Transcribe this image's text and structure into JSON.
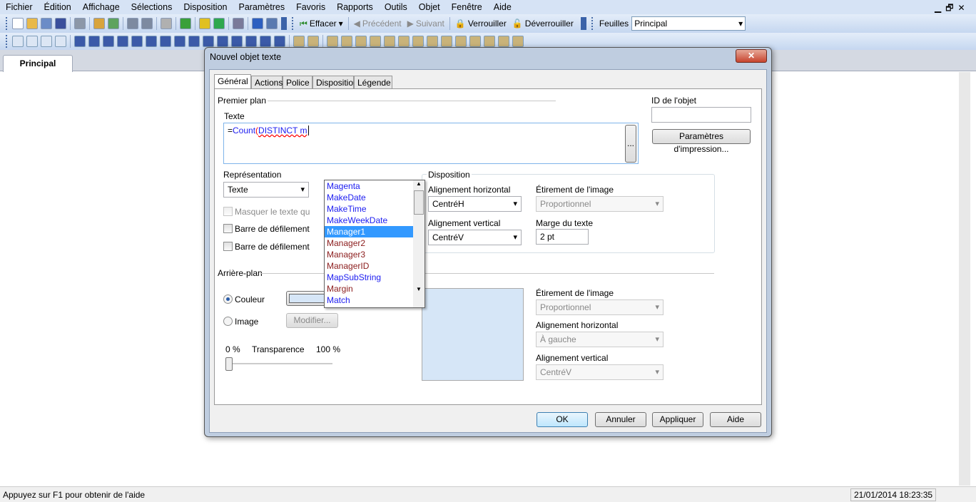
{
  "menu": [
    "Fichier",
    "Édition",
    "Affichage",
    "Sélections",
    "Disposition",
    "Paramètres",
    "Favoris",
    "Rapports",
    "Outils",
    "Objet",
    "Fenêtre",
    "Aide"
  ],
  "toolbar1": {
    "icons": [
      "new-document-icon",
      "open-folder-icon",
      "reload-icon",
      "save-icon",
      "print-icon",
      "edit-script-icon",
      "reload-data-icon",
      "undo-icon",
      "redo-icon",
      "search-icon",
      "checkmark-icon",
      "chart-wizard-icon",
      "favorite-star-icon",
      "edit-icon",
      "help-icon",
      "whats-this-icon"
    ],
    "effacer": "Effacer",
    "precedent": "Précédent",
    "suivant": "Suivant",
    "verrouiller": "Verrouiller",
    "deverrouiller": "Déverrouiller",
    "feuilles_label": "Feuilles",
    "feuille_value": "Principal"
  },
  "toolbar2": {
    "icons": [
      "new-sheet-icon",
      "move-left-icon",
      "move-right-icon",
      "sheet-properties-icon",
      "listbox-icon",
      "statistics-box-icon",
      "multibox-icon",
      "table-box-icon",
      "chart-icon",
      "input-box-icon",
      "current-selections-icon",
      "button-icon",
      "text-object-icon",
      "line-arrow-icon",
      "slider-icon",
      "bookmark-icon",
      "search-object-icon",
      "container-icon",
      "custom-object-icon",
      "format-painter-icon",
      "brush-icon",
      "align-icon",
      "align-left-icon",
      "align-center-icon",
      "align-right-icon",
      "align-bottom-icon",
      "align-middle-icon",
      "align-top-icon",
      "space-horizontal-icon",
      "space-vertical-icon",
      "lock-icon",
      "key-icon",
      "note-icon",
      "tools-icon",
      "chart-small-icon"
    ]
  },
  "sheet_tab": "Principal",
  "status": {
    "help": "Appuyez sur F1 pour obtenir de l'aide",
    "datetime": "21/01/2014 18:23:35"
  },
  "dialog": {
    "title": "Nouvel objet texte",
    "close": "✕",
    "tabs": [
      "Général",
      "Actions",
      "Police",
      "Disposition",
      "Légende"
    ],
    "premier_plan": "Premier plan",
    "texte_label": "Texte",
    "expr": {
      "eq": "=",
      "fn": "Count",
      "paren": "(",
      "rest": "DISTINCT m"
    },
    "expr_button": "...",
    "autocomplete": [
      {
        "text": "Magenta",
        "kind": "fn"
      },
      {
        "text": "MakeDate",
        "kind": "fn"
      },
      {
        "text": "MakeTime",
        "kind": "fn"
      },
      {
        "text": "MakeWeekDate",
        "kind": "fn"
      },
      {
        "text": "Manager1",
        "kind": "sel"
      },
      {
        "text": "Manager2",
        "kind": "fld"
      },
      {
        "text": "Manager3",
        "kind": "fld"
      },
      {
        "text": "ManagerID",
        "kind": "fld"
      },
      {
        "text": "MapSubString",
        "kind": "fn"
      },
      {
        "text": "Margin",
        "kind": "fld"
      },
      {
        "text": "Match",
        "kind": "fn"
      }
    ],
    "id_label": "ID de l'objet",
    "id_value": "",
    "print_params": "Paramètres d'impression...",
    "representation_label": "Représentation",
    "representation_value": "Texte",
    "masquer": "Masquer le texte quand...",
    "barre_h": "Barre de défilement horizontale",
    "barre_v": "Barre de défilement verticale",
    "disposition": {
      "title": "Disposition",
      "align_h_label": "Alignement horizontal",
      "align_h": "CentréH",
      "etirement_label": "Étirement de l'image",
      "etirement": "Proportionnel",
      "align_v_label": "Alignement vertical",
      "align_v": "CentréV",
      "marge_label": "Marge du texte",
      "marge": "2 pt"
    },
    "arriere_plan": "Arrière-plan",
    "couleur": "Couleur",
    "image": "Image",
    "modifier": "Modifier...",
    "color_value": "#d6e6f7",
    "transp_min": "0 %",
    "transp_label": "Transparence",
    "transp_max": "100 %",
    "transparency": 0,
    "bg": {
      "etirement_label": "Étirement de l'image",
      "etirement": "Proportionnel",
      "align_h_label": "Alignement horizontal",
      "align_h": "À gauche",
      "align_v_label": "Alignement vertical",
      "align_v": "CentréV"
    },
    "buttons": {
      "ok": "OK",
      "annuler": "Annuler",
      "appliquer": "Appliquer",
      "aide": "Aide"
    }
  }
}
